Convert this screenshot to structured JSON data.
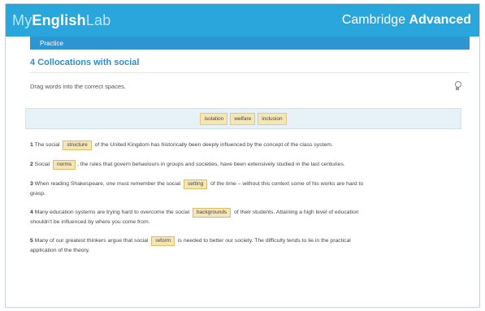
{
  "header": {
    "logo_my": "My",
    "logo_english": "English",
    "logo_lab": "Lab",
    "course_prefix": "Cambridge ",
    "course_level": "Advanced"
  },
  "subbar": {
    "label": "Practice"
  },
  "exercise": {
    "title": "4 Collocations with social",
    "instruction": "Drag words into the correct spaces."
  },
  "word_bank": [
    "isolation",
    "welfare",
    "inclusion"
  ],
  "questions": [
    {
      "number": "1",
      "before": "The social",
      "answer": "structure",
      "after": "of the United Kingdom has historically been deeply influenced by the concept of the class system."
    },
    {
      "number": "2",
      "before": "Social",
      "answer": "norms",
      "after": ", the rules that govern behaviours in groups and societies, have been extensively studied in the last centuries."
    },
    {
      "number": "3",
      "before": "When reading Shakespeare, one must remember the social",
      "answer": "setting",
      "after": "of the time – without this context some of his works are hard to grasp."
    },
    {
      "number": "4",
      "before": "Many education systems are trying hard to overcome the social",
      "answer": "backgrounds",
      "after": "of their students. Attaining a high level of education shouldn't be influenced by where you come from."
    },
    {
      "number": "5",
      "before": "Many of our greatest thinkers argue that social",
      "answer": "reform",
      "after": "is needed to better our society. The difficulty tends to lie in the practical application of the theory."
    }
  ],
  "icons": {
    "hint": "lightbulb-icon"
  },
  "colors": {
    "header": "#29a6dc",
    "subbar": "#2e95d3",
    "title": "#2c8fcc",
    "chip": "#f6e6b6"
  }
}
